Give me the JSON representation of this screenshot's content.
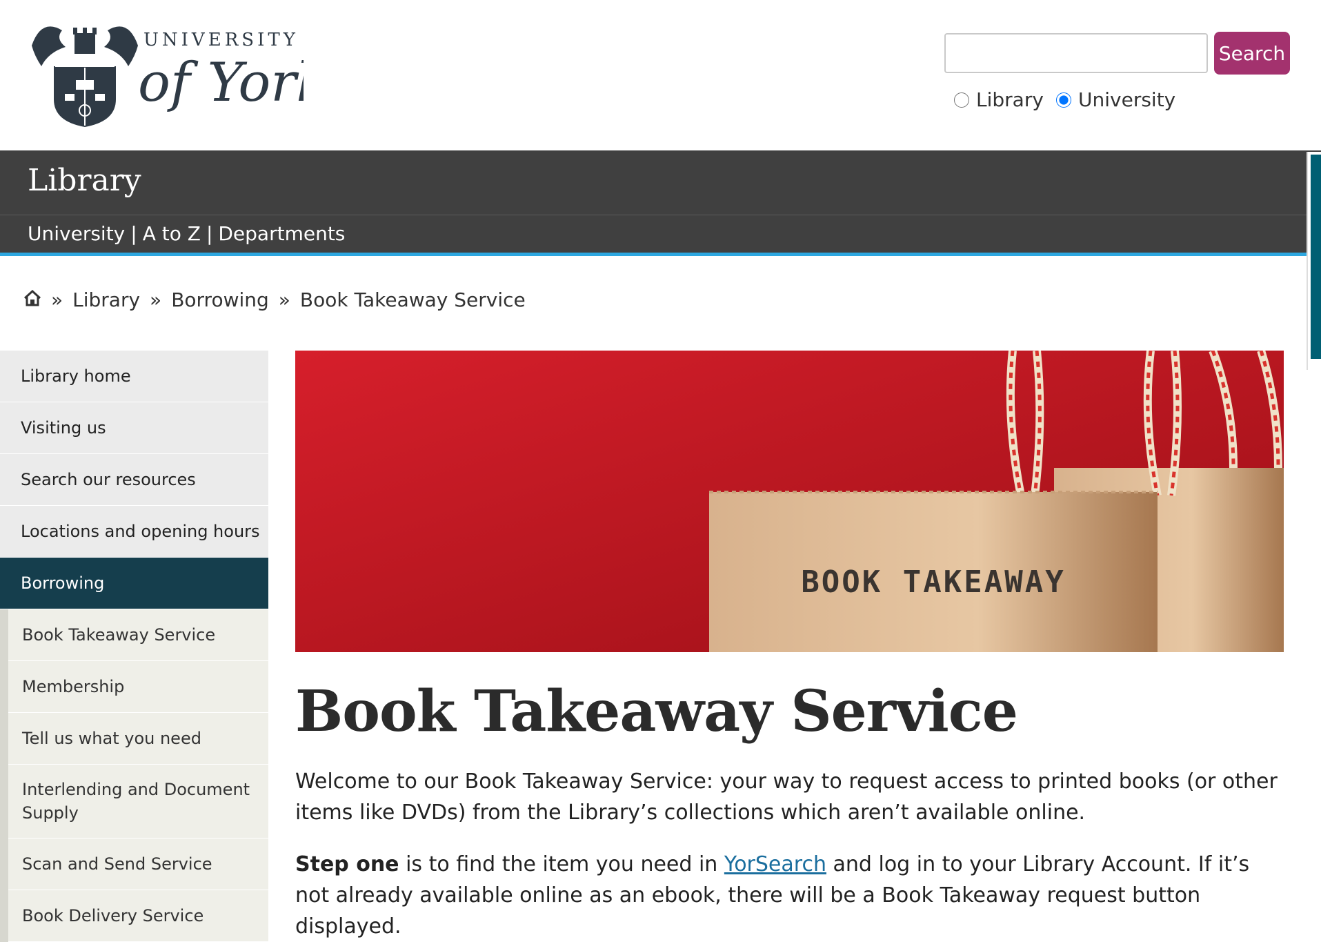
{
  "header": {
    "logo_line1": "UNIVERSITY",
    "logo_line2": "of York",
    "search_value": "",
    "search_button": "Search",
    "scope_options": [
      "Library",
      "University"
    ],
    "scope_selected": "University"
  },
  "site_bar": {
    "title": "Library",
    "links": [
      "University",
      "|",
      "A to Z",
      "|",
      "Departments"
    ]
  },
  "breadcrumb": {
    "home_icon": "home-icon",
    "separator": "»",
    "items": [
      "Library",
      "Borrowing",
      "Book Takeaway Service"
    ]
  },
  "sidebar": {
    "items": [
      "Library home",
      "Visiting us",
      "Search our resources",
      "Locations and opening hours",
      "Borrowing"
    ],
    "active": "Borrowing",
    "subitems": [
      "Book Takeaway Service",
      "Membership",
      "Tell us what you need",
      "Interlending and Document Supply",
      "Scan and Send Service",
      "Book Delivery Service"
    ]
  },
  "hero": {
    "bag_text": "BOOK TAKEAWAY"
  },
  "main": {
    "title": "Book Takeaway Service",
    "para1": "Welcome to our Book Takeaway Service: your way to request access to printed books (or other items like DVDs) from the Library’s collections which aren’t available online.",
    "para2_bold": "Step one",
    "para2_a": " is to find the item you need in ",
    "para2_link": "YorSearch",
    "para2_b": " and log in to your Library Account. If it’s not already available online as an ebook, there will be a Book Takeaway request button displayed."
  },
  "colors": {
    "accent_button": "#a3326e",
    "site_bar": "#404040",
    "site_bar_underline": "#2da7e0",
    "nav_active": "#153e4d",
    "link": "#1a6e9e",
    "hero_red": "#d11f2a"
  }
}
